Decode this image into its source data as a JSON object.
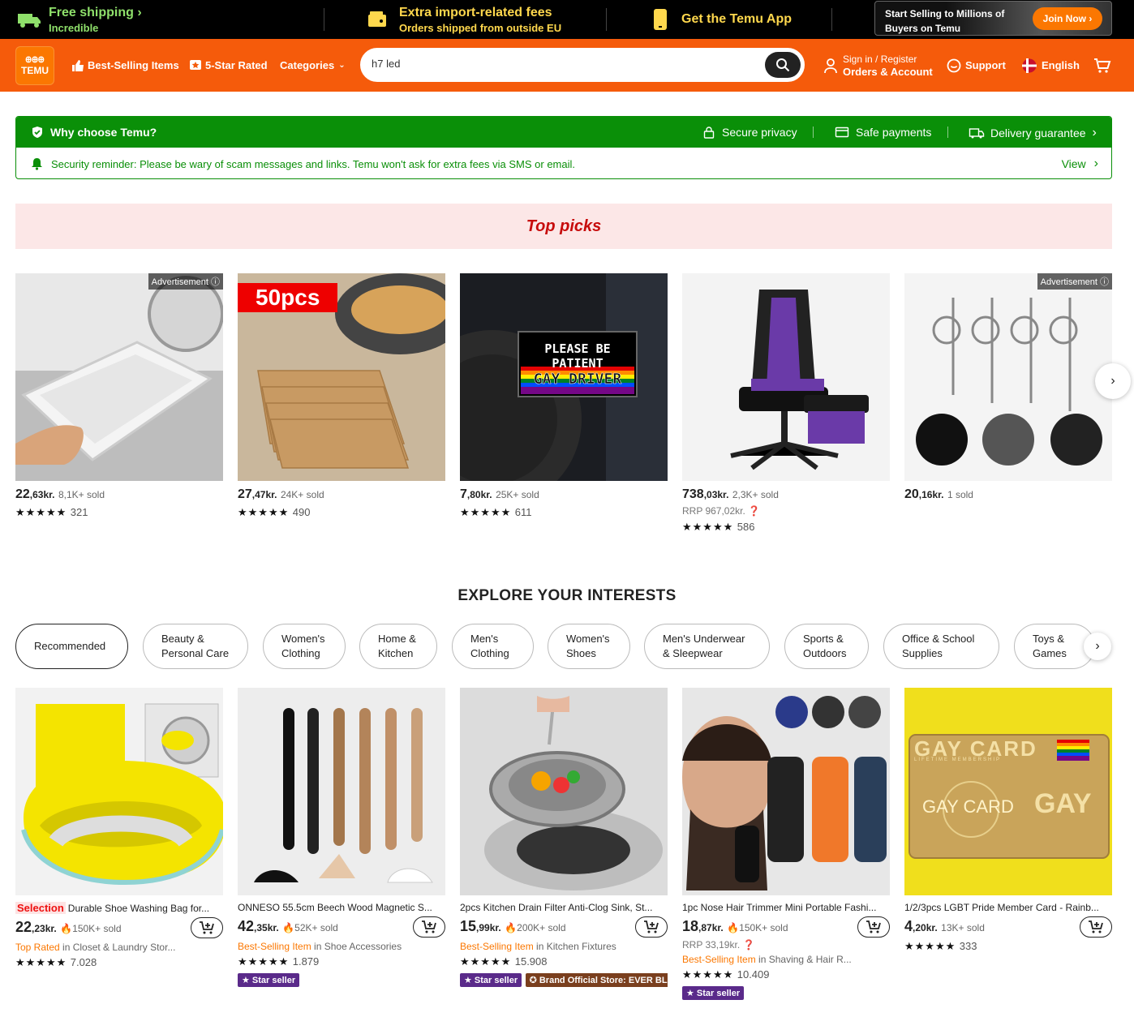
{
  "topbar": {
    "free_shipping": "Free shipping",
    "free_shipping_sub": "Incredible",
    "fees_title": "Extra import-related fees",
    "fees_sub": "Orders shipped from outside EU",
    "app": "Get the Temu App",
    "sell_line1": "Start Selling to Millions of",
    "sell_line2": "Buyers on Temu",
    "join": "Join Now"
  },
  "header": {
    "logo_top": "ꚚꚚꚚ",
    "logo": "TEMU",
    "best_selling": "Best-Selling Items",
    "five_star": "5-Star Rated",
    "categories": "Categories",
    "search_value": "h7 led",
    "sign_in": "Sign in / Register",
    "orders": "Orders & Account",
    "support": "Support",
    "language": "English"
  },
  "why": {
    "title": "Why choose Temu?",
    "privacy": "Secure privacy",
    "payments": "Safe payments",
    "delivery": "Delivery guarantee",
    "reminder": "Security reminder: Please be wary of scam messages and links. Temu won't ask for extra fees via SMS or email.",
    "view": "View"
  },
  "top_picks": {
    "title": "Top picks",
    "ad_label": "Advertisement",
    "items": [
      {
        "price_int": "22",
        "price_dec": ",63kr.",
        "sold": "8,1K+ sold",
        "stars": "★★★★★",
        "reviews": "321"
      },
      {
        "price_int": "27",
        "price_dec": ",47kr.",
        "sold": "24K+ sold",
        "stars": "★★★★★",
        "reviews": "490",
        "badge": "50pcs"
      },
      {
        "price_int": "7",
        "price_dec": ",80kr.",
        "sold": "25K+ sold",
        "stars": "★★★★★",
        "reviews": "611",
        "img_line1": "PLEASE BE PATIENT",
        "img_line2": "GAY DRIVER"
      },
      {
        "price_int": "738",
        "price_dec": ",03kr.",
        "sold": "2,3K+ sold",
        "rrp": "RRP 967,02kr.",
        "stars": "★★★★★",
        "reviews": "586"
      },
      {
        "price_int": "20",
        "price_dec": ",16kr.",
        "sold": "1 sold"
      }
    ]
  },
  "explore": {
    "title": "EXPLORE YOUR INTERESTS",
    "pills": [
      {
        "l1": "Recommended",
        "l2": ""
      },
      {
        "l1": "Beauty &",
        "l2": "Personal Care"
      },
      {
        "l1": "Women's",
        "l2": "Clothing"
      },
      {
        "l1": "Home &",
        "l2": "Kitchen"
      },
      {
        "l1": "Men's",
        "l2": "Clothing"
      },
      {
        "l1": "Women's",
        "l2": "Shoes"
      },
      {
        "l1": "Men's Underwear",
        "l2": "& Sleepwear"
      },
      {
        "l1": "Sports &",
        "l2": "Outdoors"
      },
      {
        "l1": "Office & School",
        "l2": "Supplies"
      },
      {
        "l1": "Toys &",
        "l2": "Games"
      }
    ]
  },
  "products": [
    {
      "prefix": "Selection",
      "title": "Durable Shoe Washing Bag for...",
      "price_int": "22",
      "price_dec": ",23kr.",
      "sold": "150K+ sold",
      "rank": "Top Rated",
      "rank_in": " in Closet & Laundry Stor...",
      "stars": "★★★★★",
      "reviews": "7.028"
    },
    {
      "title": "ONNESO 55.5cm Beech Wood Magnetic S...",
      "price_int": "42",
      "price_dec": ",35kr.",
      "sold": "52K+ sold",
      "rank": "Best-Selling Item",
      "rank_in": " in Shoe Accessories",
      "stars": "★★★★★",
      "reviews": "1.879",
      "badge": "Star seller"
    },
    {
      "title": "2pcs Kitchen Drain Filter Anti-Clog Sink, St...",
      "price_int": "15",
      "price_dec": ",99kr.",
      "sold": "200K+ sold",
      "rank": "Best-Selling Item",
      "rank_in": " in Kitchen Fixtures",
      "stars": "★★★★★",
      "reviews": "15.908",
      "badge": "Star seller",
      "badge2": "Brand Official Store: EVER BLOC"
    },
    {
      "title": "1pc Nose Hair Trimmer Mini Portable Fashi...",
      "price_int": "18",
      "price_dec": ",87kr.",
      "sold": "150K+ sold",
      "rrp": "RRP 33,19kr.",
      "rank": "Best-Selling Item",
      "rank_in": " in Shaving & Hair R...",
      "stars": "★★★★★",
      "reviews": "10.409",
      "badge": "Star seller"
    },
    {
      "title": "1/2/3pcs LGBT Pride Member Card - Rainb...",
      "price_int": "4",
      "price_dec": ",20kr.",
      "sold": "13K+ sold",
      "stars": "★★★★★",
      "reviews": "333",
      "img_t1": "GAY CARD",
      "img_t2": "LIFETIME MEMBERSHIP",
      "img_t3": "GAY CARD",
      "img_t4": "GAY"
    }
  ],
  "colors": {
    "brand": "#f55b0b",
    "green": "#0a8f08",
    "toppicks_bg": "#fce7e7",
    "toppicks_text": "#c70c0c"
  }
}
